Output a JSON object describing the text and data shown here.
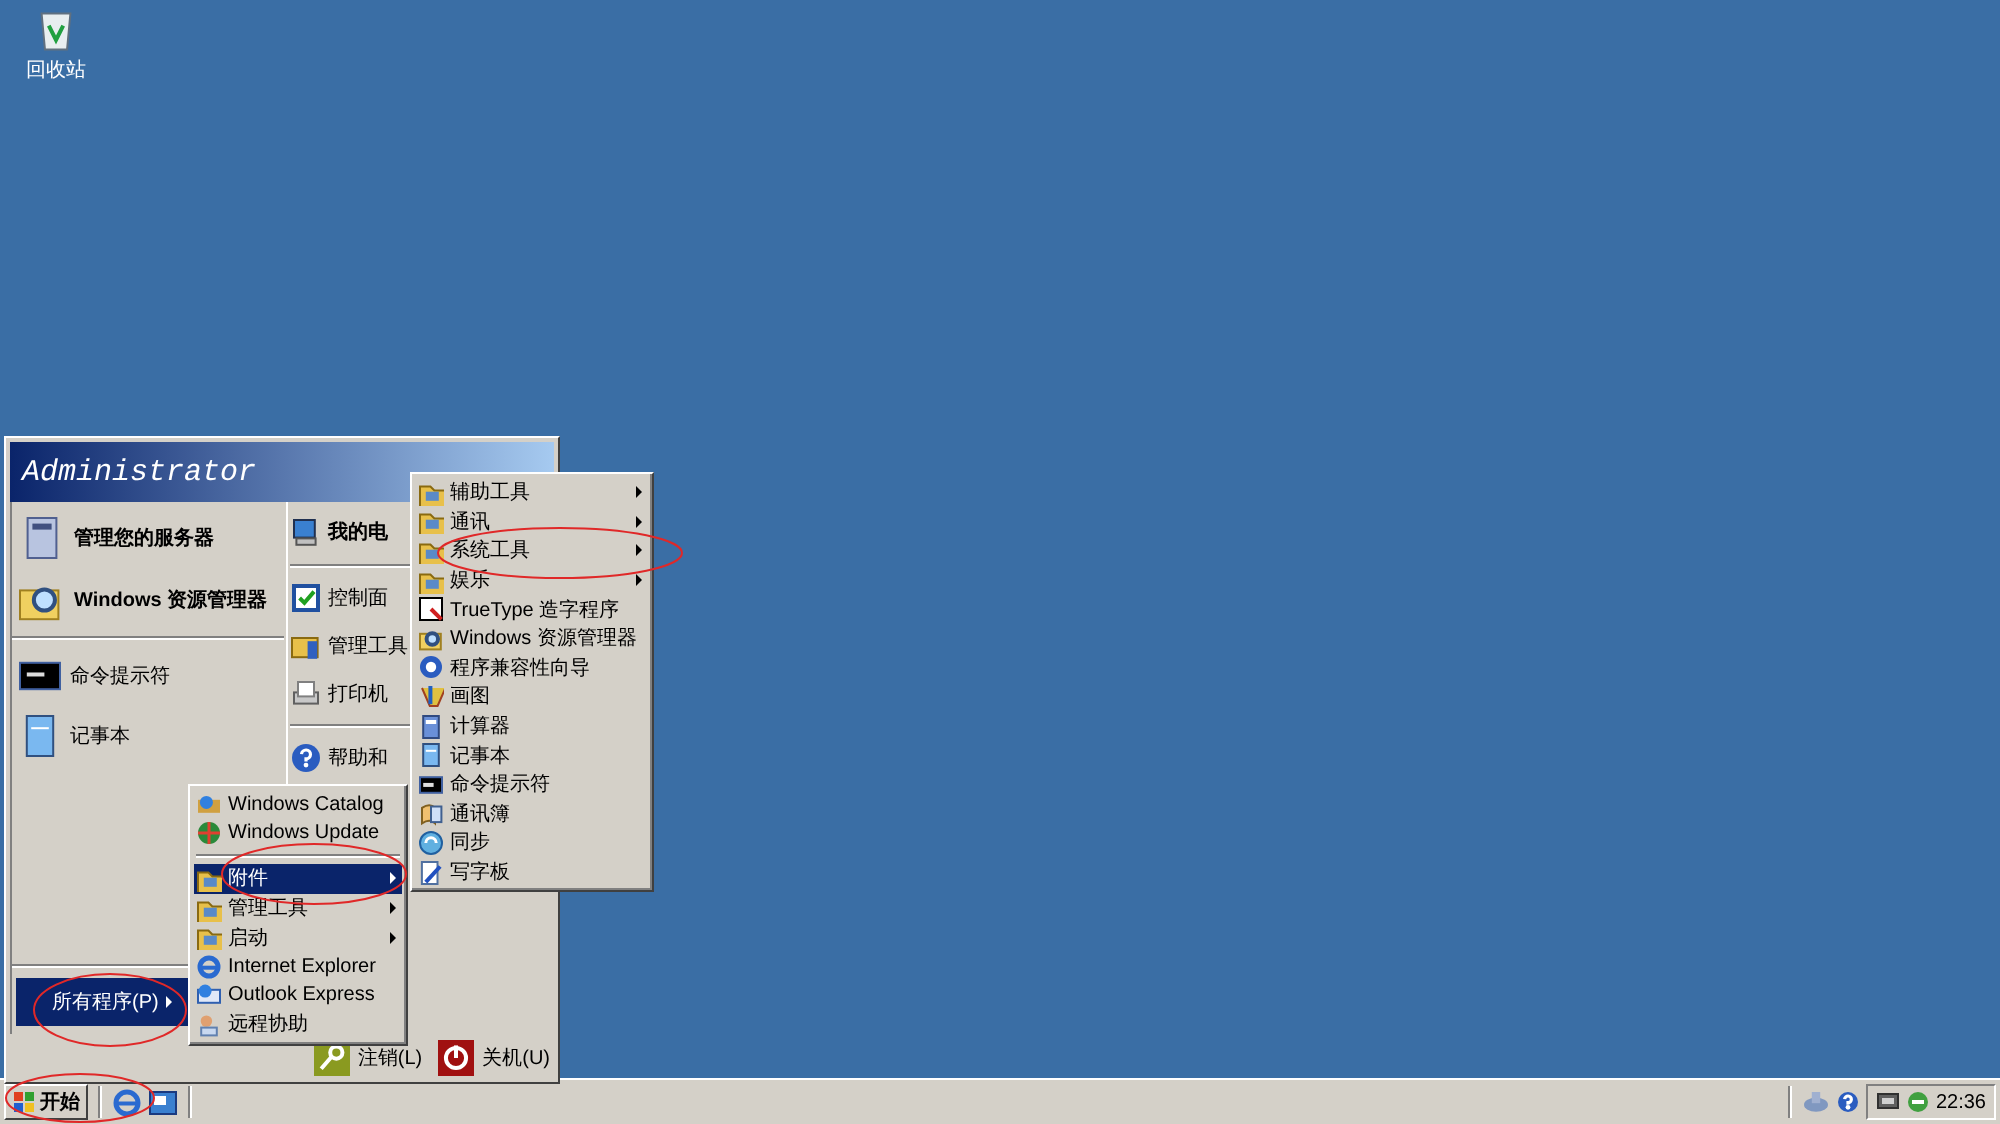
{
  "desktop_icons": [
    {
      "label": "回收站"
    }
  ],
  "start_menu": {
    "user": "Administrator",
    "pinned": [
      {
        "label": "管理您的服务器"
      },
      {
        "label": "Windows 资源管理器"
      }
    ],
    "recent": [
      {
        "label": "命令提示符"
      },
      {
        "label": "记事本"
      }
    ],
    "all_programs": {
      "label": "所有程序(P)",
      "selected": true
    },
    "places": [
      {
        "kind": "item",
        "label": "我的电"
      },
      {
        "kind": "separator"
      },
      {
        "kind": "item",
        "label": "控制面"
      },
      {
        "kind": "item",
        "label": "管理工具"
      },
      {
        "kind": "item",
        "label": "打印机"
      },
      {
        "kind": "separator"
      },
      {
        "kind": "item",
        "label": "帮助和"
      }
    ],
    "footer_buttons": [
      {
        "label": "注销(L)"
      },
      {
        "label": "关机(U)"
      }
    ]
  },
  "programs_menu": {
    "items": [
      {
        "kind": "item",
        "label": "Windows Catalog",
        "submenu": false,
        "selected": false
      },
      {
        "kind": "item",
        "label": "Windows Update",
        "submenu": false,
        "selected": false
      },
      {
        "kind": "separator"
      },
      {
        "kind": "item",
        "label": "附件",
        "submenu": true,
        "selected": true
      },
      {
        "kind": "item",
        "label": "管理工具",
        "submenu": true,
        "selected": false
      },
      {
        "kind": "item",
        "label": "启动",
        "submenu": true,
        "selected": false
      },
      {
        "kind": "item",
        "label": "Internet Explorer",
        "submenu": false,
        "selected": false
      },
      {
        "kind": "item",
        "label": "Outlook Express",
        "submenu": false,
        "selected": false
      },
      {
        "kind": "item",
        "label": "远程协助",
        "submenu": false,
        "selected": false
      }
    ]
  },
  "accessories_menu": {
    "items": [
      {
        "kind": "item",
        "label": "辅助工具",
        "submenu": true,
        "selected": false
      },
      {
        "kind": "item",
        "label": "通讯",
        "submenu": true,
        "selected": false
      },
      {
        "kind": "item",
        "label": "系统工具",
        "submenu": true,
        "selected": false
      },
      {
        "kind": "item",
        "label": "娱乐",
        "submenu": true,
        "selected": false
      },
      {
        "kind": "item",
        "label": "TrueType 造字程序",
        "submenu": false,
        "selected": false
      },
      {
        "kind": "item",
        "label": "Windows 资源管理器",
        "submenu": false,
        "selected": false
      },
      {
        "kind": "item",
        "label": "程序兼容性向导",
        "submenu": false,
        "selected": false
      },
      {
        "kind": "item",
        "label": "画图",
        "submenu": false,
        "selected": false
      },
      {
        "kind": "item",
        "label": "计算器",
        "submenu": false,
        "selected": false
      },
      {
        "kind": "item",
        "label": "记事本",
        "submenu": false,
        "selected": false
      },
      {
        "kind": "item",
        "label": "命令提示符",
        "submenu": false,
        "selected": false
      },
      {
        "kind": "item",
        "label": "通讯簿",
        "submenu": false,
        "selected": false
      },
      {
        "kind": "item",
        "label": "同步",
        "submenu": false,
        "selected": false
      },
      {
        "kind": "item",
        "label": "写字板",
        "submenu": false,
        "selected": false
      }
    ]
  },
  "taskbar": {
    "start_label": "开始",
    "clock": "22:36"
  },
  "annotations": [
    {
      "kind": "ellipse"
    },
    {
      "kind": "ellipse"
    },
    {
      "kind": "ellipse"
    },
    {
      "kind": "ellipse"
    }
  ]
}
